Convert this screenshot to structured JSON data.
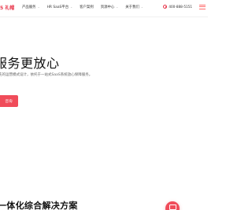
{
  "header": {
    "logo": "5 礼帽",
    "nav": [
      {
        "label": "产品服务",
        "has_dropdown": true
      },
      {
        "label": "HR SaaS平台",
        "has_dropdown": true
      },
      {
        "label": "客户案例",
        "has_dropdown": false
      },
      {
        "label": "资源中心",
        "has_dropdown": true
      },
      {
        "label": "关于我们",
        "has_dropdown": true
      }
    ],
    "phone": "400-888-5151"
  },
  "hero": {
    "title": "服务更放心",
    "description": "先的运营模式设计，依托于一站式SaaS系统放心保障服务。",
    "cta": "咨询"
  },
  "section": {
    "title": "一体化综合解决方案"
  },
  "colors": {
    "accent": "#f04c5a"
  }
}
